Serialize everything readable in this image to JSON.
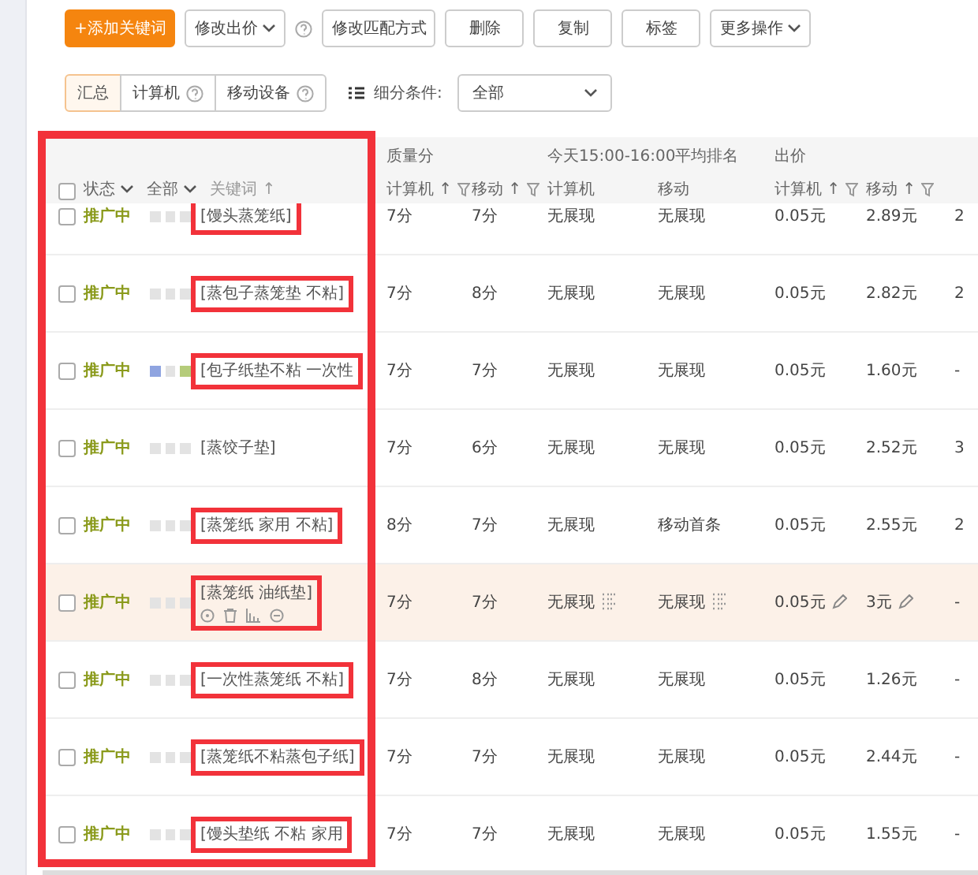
{
  "toolbar": [
    {
      "kind": "primary",
      "label": "+添加关键词"
    },
    {
      "kind": "dropdown",
      "label": "修改出价",
      "help": true
    },
    {
      "kind": "plain",
      "label": "修改匹配方式"
    },
    {
      "kind": "plain",
      "label": "删除"
    },
    {
      "kind": "plain",
      "label": "复制"
    },
    {
      "kind": "plain",
      "label": "标签"
    },
    {
      "kind": "dropdown",
      "label": "更多操作",
      "help": false
    }
  ],
  "device_tabs": [
    {
      "label": "汇总",
      "selected": true,
      "help": false
    },
    {
      "label": "计算机",
      "selected": false,
      "help": true
    },
    {
      "label": "移动设备",
      "selected": false,
      "help": true
    }
  ],
  "segment": {
    "label": "细分条件:",
    "value": "全部"
  },
  "table": {
    "select_all_checked": false,
    "frame_highlighted": true,
    "status_filter": "状态",
    "tag_filter": "全部",
    "keyword_header": {
      "label": "关键词",
      "sort": "↑"
    },
    "groups": [
      {
        "label": "质量分"
      },
      {
        "label": "今天15:00-16:00平均排名"
      },
      {
        "label": "出价"
      }
    ],
    "subcolumns": [
      {
        "label": "计算机",
        "sort": "↑",
        "filter": true
      },
      {
        "label": "移动",
        "sort": "↑",
        "filter": true
      },
      {
        "label": "计算机",
        "filter": false
      },
      {
        "label": "移动",
        "filter": false
      },
      {
        "label": "计算机",
        "sort": "↑",
        "filter": true
      },
      {
        "label": "移动",
        "sort": "↑",
        "filter": true
      }
    ],
    "rows": [
      {
        "checked": false,
        "status": "推广中",
        "markers": [
          {
            "color": "#e3e3e3"
          },
          {
            "color": "#e3e3e3"
          },
          {
            "color": "#e3e3e3"
          }
        ],
        "keyword": "[馒头蒸笼纸]",
        "outlined": true,
        "highlighted": false,
        "quality_pc": "7分",
        "quality_mobile": "7分",
        "rank_pc": "无展现",
        "rank_mobile": "无展现",
        "bid_pc": "0.05元",
        "bid_mobile": "2.89元",
        "column_9": "2"
      },
      {
        "checked": false,
        "status": "推广中",
        "markers": [
          {
            "color": "#e3e3e3"
          },
          {
            "color": "#e3e3e3"
          },
          {
            "color": "#e3e3e3"
          }
        ],
        "keyword": "[蒸包子蒸笼垫 不粘]",
        "outlined": true,
        "highlighted": false,
        "quality_pc": "7分",
        "quality_mobile": "8分",
        "rank_pc": "无展现",
        "rank_mobile": "无展现",
        "bid_pc": "0.05元",
        "bid_mobile": "2.82元",
        "column_9": "2"
      },
      {
        "checked": false,
        "status": "推广中",
        "markers": [
          {
            "color": "#8fa4e0"
          },
          {
            "color": "#e3e3e3"
          },
          {
            "color": "#b5cc7a"
          }
        ],
        "keyword": "[包子纸垫不粘 一次性",
        "outlined": true,
        "highlighted": false,
        "quality_pc": "7分",
        "quality_mobile": "7分",
        "rank_pc": "无展现",
        "rank_mobile": "无展现",
        "bid_pc": "0.05元",
        "bid_mobile": "1.60元",
        "column_9": "-"
      },
      {
        "checked": false,
        "status": "推广中",
        "markers": [
          {
            "color": "#e3e3e3"
          },
          {
            "color": "#e3e3e3"
          },
          {
            "color": "#e3e3e3"
          }
        ],
        "keyword": "[蒸饺子垫]",
        "outlined": false,
        "highlighted": false,
        "quality_pc": "7分",
        "quality_mobile": "6分",
        "rank_pc": "无展现",
        "rank_mobile": "无展现",
        "bid_pc": "0.05元",
        "bid_mobile": "2.52元",
        "column_9": "3"
      },
      {
        "checked": false,
        "status": "推广中",
        "markers": [
          {
            "color": "#e3e3e3"
          },
          {
            "color": "#e3e3e3"
          },
          {
            "color": "#e3e3e3"
          }
        ],
        "keyword": "[蒸笼纸 家用 不粘]",
        "outlined": true,
        "highlighted": false,
        "quality_pc": "8分",
        "quality_mobile": "7分",
        "rank_pc": "无展现",
        "rank_mobile": "移动首条",
        "bid_pc": "0.05元",
        "bid_mobile": "2.55元",
        "column_9": "2"
      },
      {
        "checked": false,
        "status": "推广中",
        "markers": [
          {
            "color": "#e3e3e3"
          },
          {
            "color": "#e3e3e3"
          },
          {
            "color": "#e3e3e3"
          }
        ],
        "keyword": "[蒸笼纸 油纸垫]",
        "outlined": true,
        "highlighted": true,
        "quality_pc": "7分",
        "quality_mobile": "7分",
        "rank_pc": "无展现",
        "rank_mobile": "无展现",
        "bid_pc": "0.05元",
        "bid_mobile": "3元",
        "column_9": "-"
      },
      {
        "checked": false,
        "status": "推广中",
        "markers": [
          {
            "color": "#e3e3e3"
          },
          {
            "color": "#e3e3e3"
          },
          {
            "color": "#e3e3e3"
          }
        ],
        "keyword": "[一次性蒸笼纸 不粘]",
        "outlined": true,
        "highlighted": false,
        "quality_pc": "7分",
        "quality_mobile": "8分",
        "rank_pc": "无展现",
        "rank_mobile": "无展现",
        "bid_pc": "0.05元",
        "bid_mobile": "1.26元",
        "column_9": "-"
      },
      {
        "checked": false,
        "status": "推广中",
        "markers": [
          {
            "color": "#e3e3e3"
          },
          {
            "color": "#e3e3e3"
          },
          {
            "color": "#e3e3e3"
          }
        ],
        "keyword": "[蒸笼纸不粘蒸包子纸]",
        "outlined": true,
        "highlighted": false,
        "quality_pc": "7分",
        "quality_mobile": "7分",
        "rank_pc": "无展现",
        "rank_mobile": "无展现",
        "bid_pc": "0.05元",
        "bid_mobile": "2.44元",
        "column_9": "-"
      },
      {
        "checked": false,
        "status": "推广中",
        "markers": [
          {
            "color": "#e3e3e3"
          },
          {
            "color": "#e3e3e3"
          },
          {
            "color": "#e3e3e3"
          }
        ],
        "keyword": "[馒头垫纸 不粘 家用",
        "outlined": true,
        "highlighted": false,
        "quality_pc": "7分",
        "quality_mobile": "7分",
        "rank_pc": "无展现",
        "rank_mobile": "无展现",
        "bid_pc": "0.05元",
        "bid_mobile": "1.55元",
        "column_9": "-"
      }
    ]
  }
}
